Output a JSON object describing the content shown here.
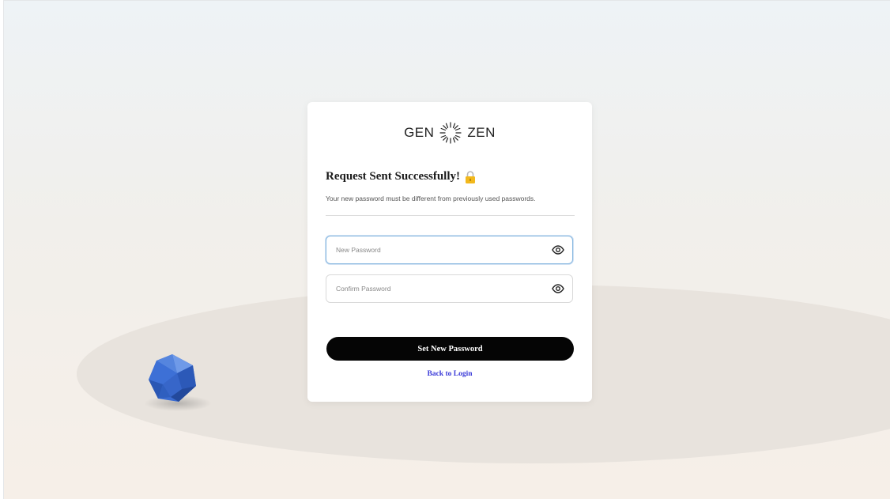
{
  "brand": {
    "left_word": "GEN",
    "right_word": "ZEN",
    "logo_icon": "starburst-logo"
  },
  "form": {
    "heading": "Request Sent Successfully!",
    "heading_icon": "lock-icon",
    "subtext": "Your new password must be different from previously used passwords.",
    "new_password": {
      "placeholder": "New Password",
      "value": "",
      "icon": "eye-icon"
    },
    "confirm_password": {
      "placeholder": "Confirm Password",
      "value": "",
      "icon": "eye-icon"
    },
    "submit_label": "Set New Password",
    "back_link_label": "Back to Login"
  },
  "colors": {
    "primary_button": "#050505",
    "link": "#3a3ad8",
    "focus_border": "#86b7e0",
    "gem": "#3f73d6"
  },
  "decor": {
    "shape_icon": "icosahedron-gem"
  }
}
